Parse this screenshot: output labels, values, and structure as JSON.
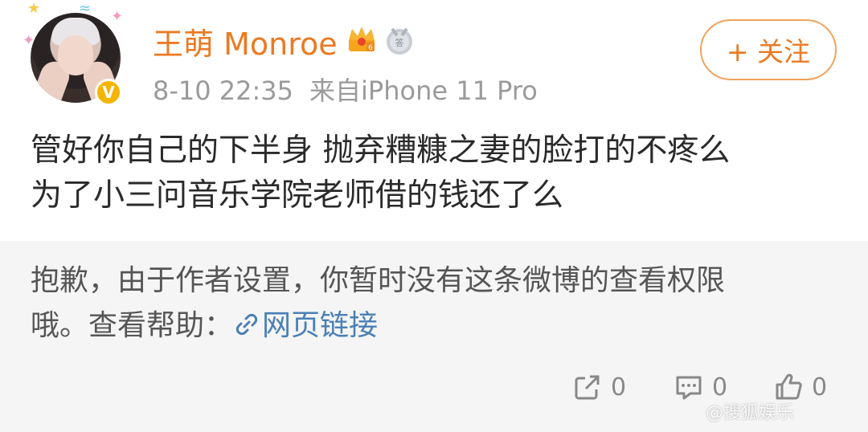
{
  "post": {
    "username": "王萌 Monroe",
    "date": "8-10 22:35",
    "source": "来自iPhone 11 Pro",
    "follow_label": "+ 关注",
    "content_lines": [
      "管好你自己的下半身 抛弃糟糠之妻的脸打的不疼么",
      "为了小三问音乐学院老师借的钱还了么"
    ],
    "icons": {
      "avatar": "user-avatar",
      "verified": "verified-badge-icon",
      "crown": "crown-badge-icon",
      "medal": "medal-icon"
    },
    "colors": {
      "username": "#eb7a23",
      "follow_border": "#f0a35c",
      "verified": "#f5b400"
    }
  },
  "notice": {
    "line1": "抱歉，由于作者设置，你暂时没有这条微博的查看权限",
    "line2_prefix": "哦。查看帮助：",
    "link_label": "网页链接",
    "link_color": "#4a7fb5",
    "background": "#f5f5f5"
  },
  "actions": {
    "share_count": "0",
    "comment_count": "0",
    "like_count": "0"
  },
  "watermark": "@搜狐娱乐"
}
